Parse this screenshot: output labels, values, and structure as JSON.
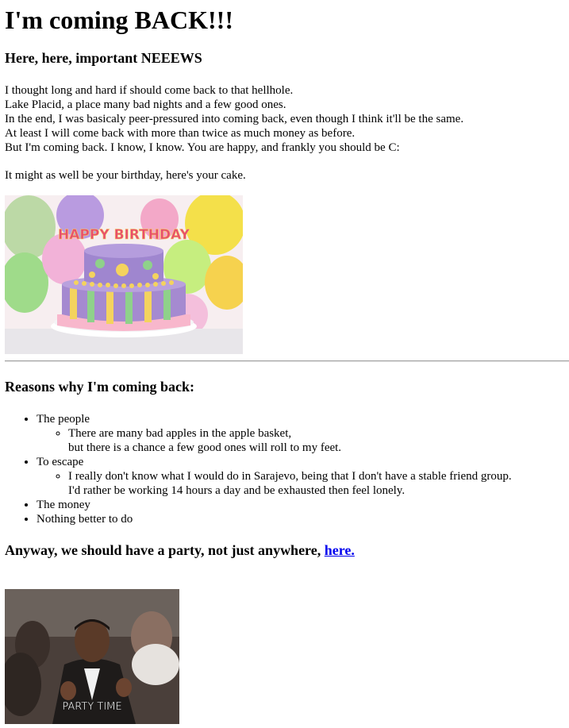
{
  "title": "I'm coming BACK!!!",
  "news": {
    "heading": "Here, here, important NEEEWS",
    "lines": [
      "I thought long and hard if should come back to that hellhole.",
      "Lake Placid, a place many bad nights and a few good ones.",
      "In the end, I was basicaly peer-pressured into coming back, even though I think it'll be the same.",
      "At least I will come back with more than twice as much money as before.",
      "But I'm coming back. I know, I know. You are happy, and frankly you should be C:"
    ],
    "cake_line": "It might as well be your birthday, here's your cake."
  },
  "cake_image": {
    "topper_text": "HAPPY BIRTHDAY"
  },
  "reasons": {
    "heading": "Reasons why I'm coming back:",
    "items": [
      {
        "label": "The people",
        "sub": [
          "There are many bad apples in the apple basket,",
          "but there is a chance a few good ones will roll to my feet."
        ]
      },
      {
        "label": "To escape",
        "sub": [
          "I really don't know what I would do in Sarajevo, being that I don't have a stable friend group.",
          "I'd rather be working 14 hours a day and be exhausted then feel lonely."
        ]
      },
      {
        "label": "The money"
      },
      {
        "label": "Nothing better to do"
      }
    ]
  },
  "party": {
    "heading_text": "Anyway, we should have a party, not just anywhere, ",
    "link_text": "here.",
    "gif_caption": "PARTY TIME"
  },
  "colors": {
    "link": "#0000ee",
    "cake_purple": "#a58ad0",
    "balloon_yellow": "#f4e04a"
  }
}
